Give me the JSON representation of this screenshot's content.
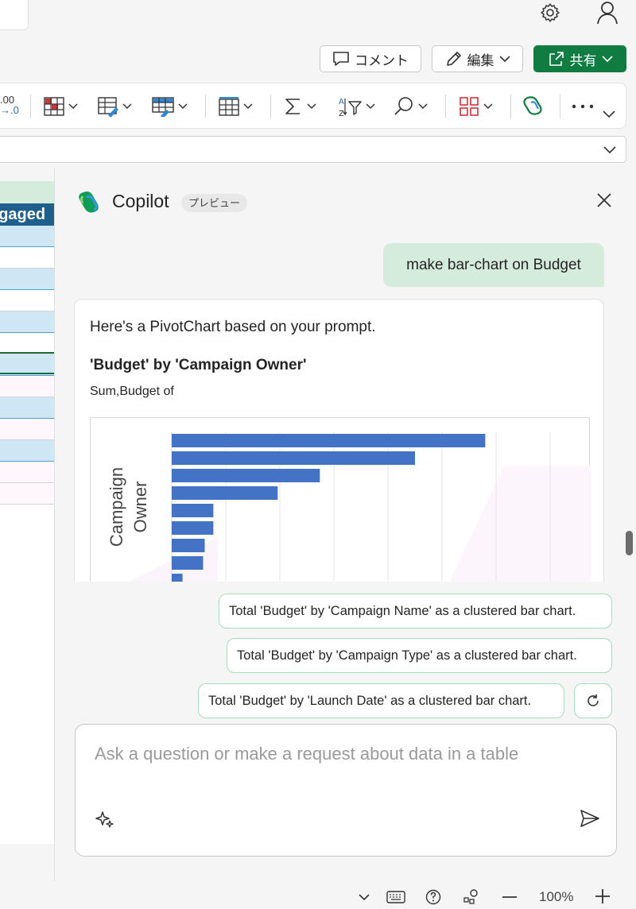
{
  "header": {
    "comment_label": "コメント",
    "edit_label": "編集",
    "share_label": "共有"
  },
  "ribbon": {
    "decimal_top": ".00",
    "decimal_bottom": "→.0"
  },
  "grid": {
    "column_header": "ngaged"
  },
  "copilot": {
    "title": "Copilot",
    "badge": "プレビュー",
    "user_message": "make bar-chart on Budget",
    "response": {
      "intro": "Here's a PivotChart based on your prompt.",
      "chart_title": "'Budget' by 'Campaign Owner'",
      "chart_subtitle": "Sum,Budget of"
    },
    "suggestions": [
      "Total 'Budget' by 'Campaign Name' as a clustered bar chart.",
      "Total 'Budget' by 'Campaign Type' as a clustered bar chart.",
      "Total 'Budget' by 'Launch Date' as a clustered bar chart."
    ],
    "input_placeholder": "Ask a question or make a request about data in a table"
  },
  "status": {
    "zoom": "100%"
  },
  "colors": {
    "accent": "#107c41",
    "bar": "#4472c4",
    "user_bubble": "#d5ecdd",
    "suggestion_border": "#a9dcbc"
  },
  "chart_data": {
    "type": "bar",
    "orientation": "horizontal",
    "ylabel": "Campaign Owner",
    "values": [
      580,
      450,
      274,
      196,
      77,
      77,
      61,
      58,
      20
    ],
    "xlim": [
      0,
      700
    ],
    "grid": true,
    "partially_visible": true
  }
}
